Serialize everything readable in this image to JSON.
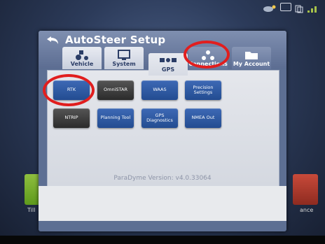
{
  "dialog": {
    "title": "AutoSteer Setup",
    "version_text": "ParaDyme Version: v4.0.33064"
  },
  "tabs": [
    {
      "label": "Vehicle",
      "icon": "tractor-icon",
      "active": false
    },
    {
      "label": "System",
      "icon": "monitor-icon",
      "active": false
    },
    {
      "label": "GPS",
      "icon": "satellite-icon",
      "active": true
    },
    {
      "label": "Connections",
      "icon": "connections-icon",
      "active": false
    },
    {
      "label": "My Account",
      "icon": "folder-icon",
      "active": false
    }
  ],
  "gps_buttons": [
    {
      "label": "RTK",
      "style": "blue"
    },
    {
      "label": "OmniSTAR",
      "style": "dark"
    },
    {
      "label": "WAAS",
      "style": "blue"
    },
    {
      "label": "Precision Settings",
      "style": "blue"
    },
    {
      "label": "NTRIP",
      "style": "dark"
    },
    {
      "label": "Planning Tool",
      "style": "blue"
    },
    {
      "label": "GPS Diagnostics",
      "style": "blue"
    },
    {
      "label": "NMEA Out",
      "style": "blue"
    }
  ],
  "background": {
    "left_label": "Till",
    "right_label": "ance"
  },
  "highlights": [
    "Connections",
    "RTK"
  ],
  "colors": {
    "highlight": "#e11e1e",
    "button_blue": "#234c91",
    "button_dark": "#2b2b2b"
  }
}
